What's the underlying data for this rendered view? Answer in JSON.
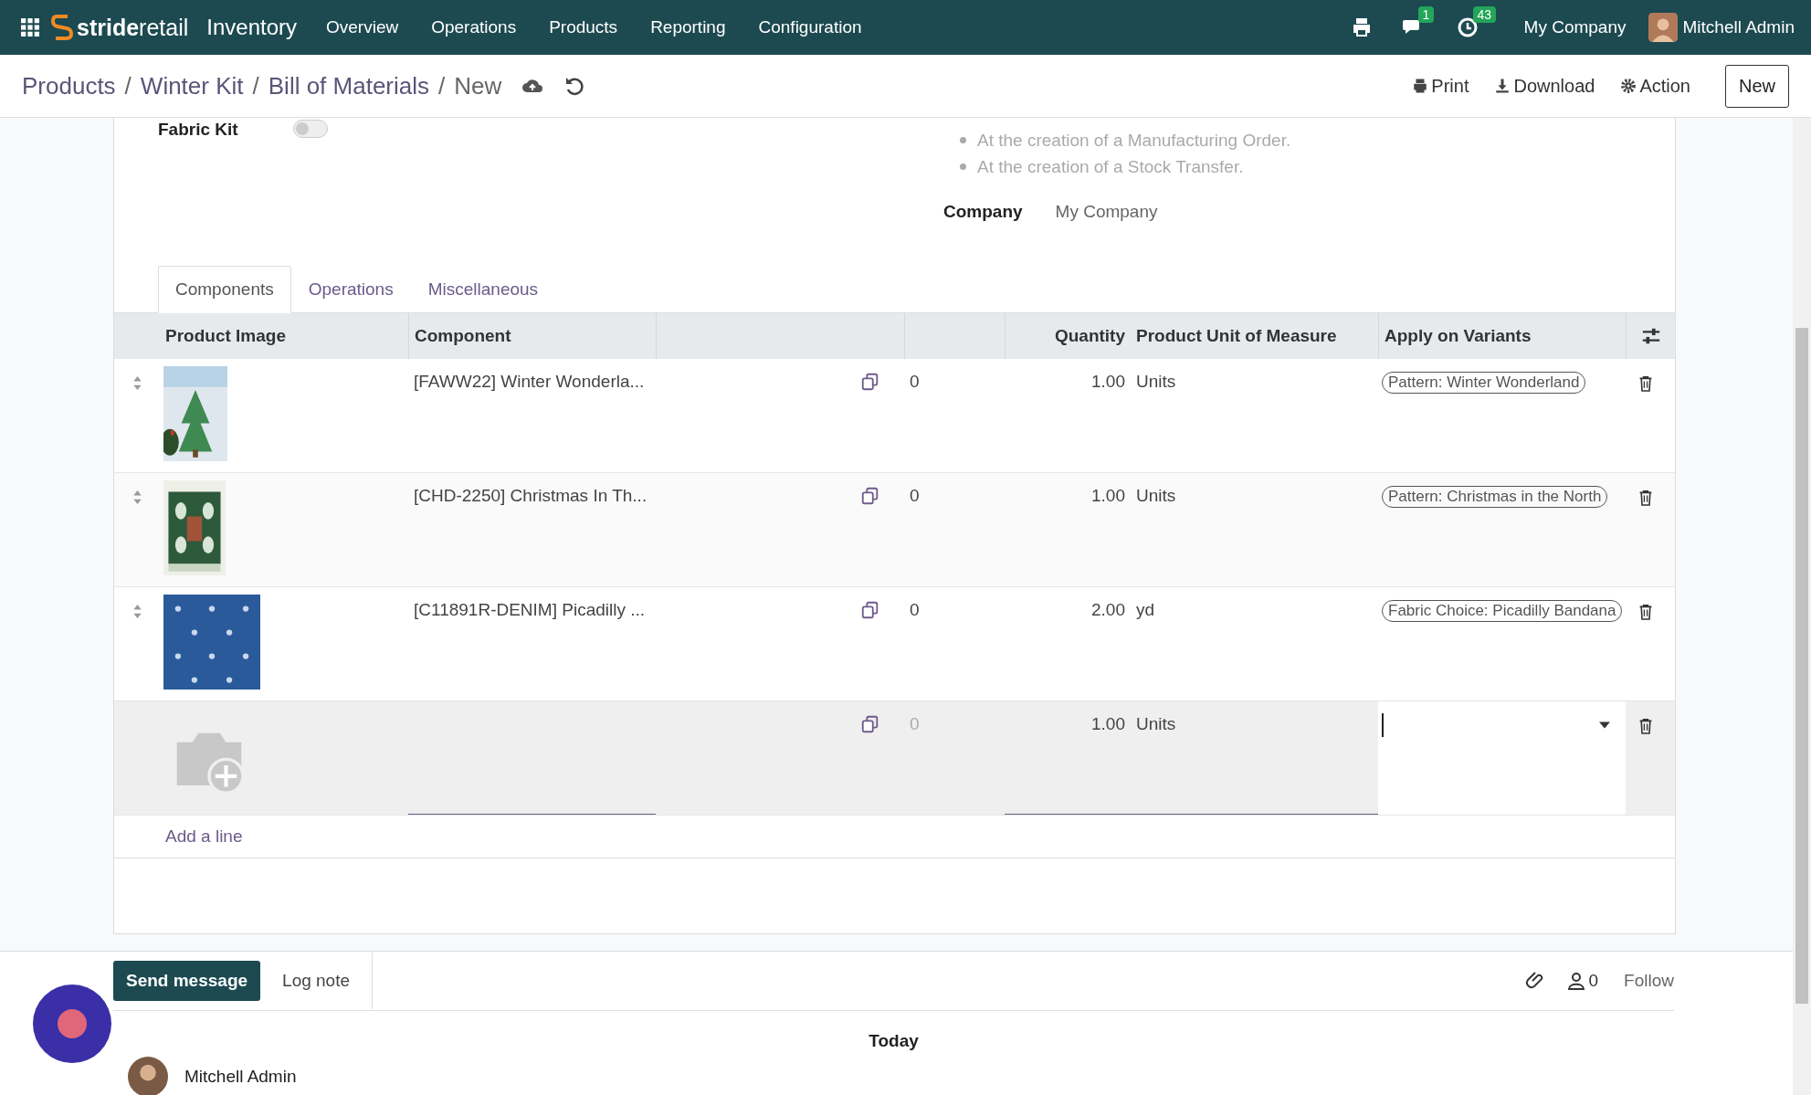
{
  "navbar": {
    "brand": "**stride**retail",
    "app": "Inventory",
    "menu": [
      "Overview",
      "Operations",
      "Products",
      "Reporting",
      "Configuration"
    ],
    "messages_badge": "1",
    "activities_badge": "43",
    "company": "My Company",
    "user": "Mitchell Admin"
  },
  "breadcrumb": [
    "Products",
    "Winter Kit",
    "Bill of Materials",
    "New"
  ],
  "breadcrumb_separator": "/",
  "actions": [
    "Print",
    "Download",
    "Action"
  ],
  "new_button": "New",
  "form": {
    "kit_label": "Fabric Kit",
    "kit_on": false,
    "notes": [
      "At the creation of a Manufacturing Order.",
      "At the creation of a Stock Transfer."
    ],
    "company_label": "Company",
    "company": "My Company"
  },
  "tabs": [
    {
      "label": "Components",
      "selected": true
    },
    {
      "label": "Operations",
      "selected": false
    },
    {
      "label": "Miscellaneous",
      "selected": false
    }
  ],
  "table": {
    "columns": [
      "Product Image",
      "Component",
      "Quantity",
      "Product Unit of Measure",
      "Apply on Variants"
    ],
    "rows": [
      {
        "kind": "line",
        "component": "[FAWW22] Winter Wonderla...",
        "forecast": "0",
        "quantity": "1.00",
        "uom": "Units",
        "variant": "Pattern: Winter Wonderland"
      },
      {
        "kind": "line",
        "component": "[CHD-2250] Christmas In Th...",
        "forecast": "0",
        "quantity": "1.00",
        "uom": "Units",
        "variant": "Pattern: Christmas in the North"
      },
      {
        "kind": "line",
        "component": "[C11891R-DENIM] Picadilly ...",
        "forecast": "0",
        "quantity": "2.00",
        "uom": "yd",
        "variant": "Fabric Choice: Picadilly Bandana"
      },
      {
        "kind": "new",
        "forecast": "0",
        "quantity": "1.00",
        "uom": "Units"
      }
    ],
    "add_line": "Add a line"
  },
  "chatter": {
    "send": "Send message",
    "log": "Log note",
    "followers": "0",
    "follow": "Follow",
    "date": "Today",
    "author": "Mitchell Admin"
  }
}
